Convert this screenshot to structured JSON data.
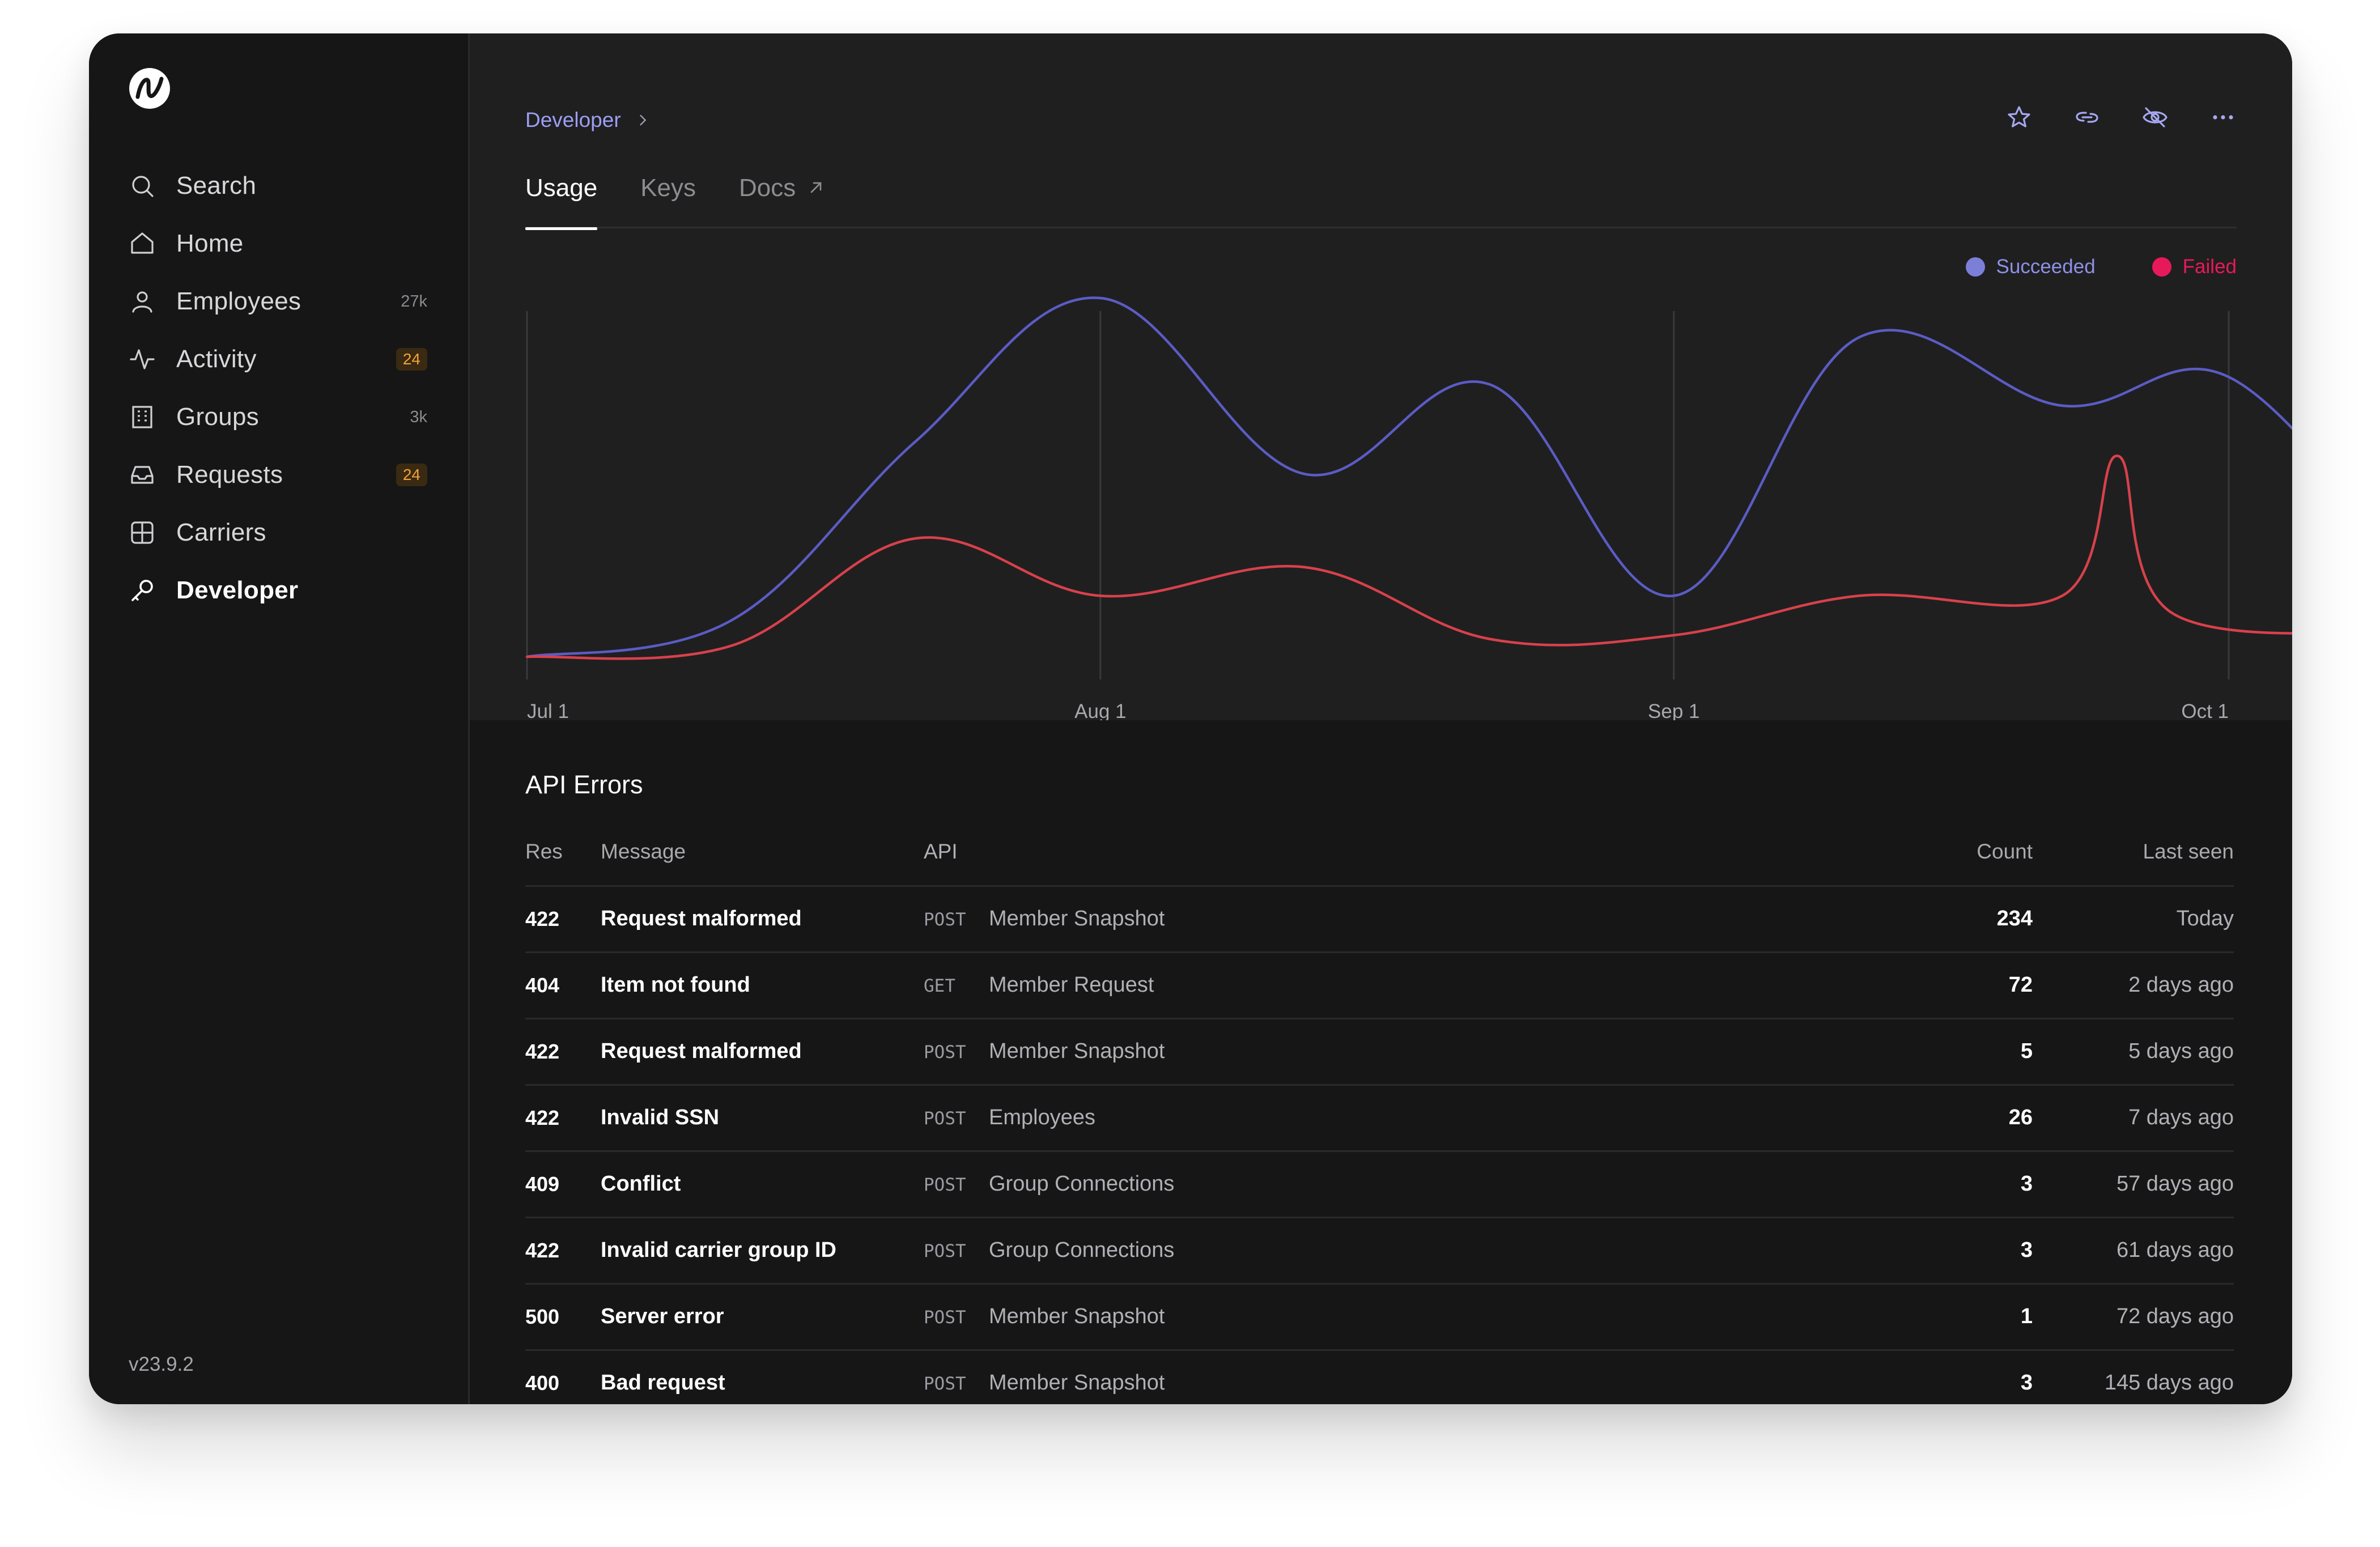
{
  "app": {
    "logo_name": "brand-logo",
    "version": "v23.9.2"
  },
  "sidebar": {
    "items": [
      {
        "name": "search",
        "label": "Search",
        "icon": "search-icon",
        "count": ""
      },
      {
        "name": "home",
        "label": "Home",
        "icon": "home-icon",
        "count": ""
      },
      {
        "name": "employees",
        "label": "Employees",
        "icon": "user-icon",
        "count": "27k"
      },
      {
        "name": "activity",
        "label": "Activity",
        "icon": "activity-icon",
        "count": "24"
      },
      {
        "name": "groups",
        "label": "Groups",
        "icon": "building-icon",
        "count": "3k"
      },
      {
        "name": "requests",
        "label": "Requests",
        "icon": "inbox-icon",
        "count": "24"
      },
      {
        "name": "carriers",
        "label": "Carriers",
        "icon": "grid-icon",
        "count": ""
      },
      {
        "name": "developer",
        "label": "Developer",
        "icon": "key-icon",
        "count": ""
      }
    ],
    "active": "Developer"
  },
  "header": {
    "breadcrumb": "Developer",
    "actions": [
      "star-icon",
      "link-icon",
      "eye-off-icon",
      "more-icon"
    ]
  },
  "tabs": {
    "usage": "Usage",
    "keys": "Keys",
    "docs": "Docs"
  },
  "colors": {
    "succeeded": "#7c7fd8",
    "failed": "#e8195a",
    "succeeded_line": "#5b5cc4",
    "failed_line": "#d8414b"
  },
  "chart_data": {
    "type": "line",
    "x_ticks": [
      "Jul 1",
      "Aug 1",
      "Sep 1",
      "Oct 1"
    ],
    "x_range": [
      "Jul 1",
      "Oct 1"
    ],
    "grid": "vertical lines at ticks",
    "legend_position": "top-right",
    "series": [
      {
        "name": "Succeeded",
        "color": "#5b5cc4",
        "points": [
          [
            "Jul 1",
            0
          ],
          [
            "Jul 12",
            10
          ],
          [
            "Jul 22",
            60
          ],
          [
            "Aug 1",
            100
          ],
          [
            "Aug 12",
            51
          ],
          [
            "Aug 22",
            76
          ],
          [
            "Sep 1",
            17
          ],
          [
            "Sep 11",
            89
          ],
          [
            "Sep 22",
            70
          ],
          [
            "Oct 1",
            78
          ],
          [
            "Oct 11",
            23
          ]
        ]
      },
      {
        "name": "Failed",
        "color": "#d8414b",
        "points": [
          [
            "Jul 1",
            0
          ],
          [
            "Jul 12",
            3
          ],
          [
            "Jul 22",
            33
          ],
          [
            "Aug 1",
            17
          ],
          [
            "Aug 12",
            25
          ],
          [
            "Aug 22",
            5
          ],
          [
            "Sep 1",
            6
          ],
          [
            "Sep 11",
            17
          ],
          [
            "Sep 22",
            17
          ],
          [
            "Sep 25",
            56
          ],
          [
            "Sep 28",
            12
          ],
          [
            "Oct 11",
            7
          ]
        ]
      }
    ]
  },
  "api_errors": {
    "title": "API Errors",
    "columns": {
      "res": "Res",
      "message": "Message",
      "api": "API",
      "count": "Count",
      "last_seen": "Last seen"
    },
    "rows": [
      {
        "res": "422",
        "message": "Request malformed",
        "method": "POST",
        "api": "Member Snapshot",
        "count": "234",
        "last_seen": "Today"
      },
      {
        "res": "404",
        "message": "Item not found",
        "method": "GET",
        "api": "Member Request",
        "count": "72",
        "last_seen": "2 days ago"
      },
      {
        "res": "422",
        "message": "Request malformed",
        "method": "POST",
        "api": "Member Snapshot",
        "count": "5",
        "last_seen": "5 days ago"
      },
      {
        "res": "422",
        "message": "Invalid SSN",
        "method": "POST",
        "api": "Employees",
        "count": "26",
        "last_seen": "7 days ago"
      },
      {
        "res": "409",
        "message": "Conflict",
        "method": "POST",
        "api": "Group Connections",
        "count": "3",
        "last_seen": "57 days ago"
      },
      {
        "res": "422",
        "message": "Invalid carrier group ID",
        "method": "POST",
        "api": "Group Connections",
        "count": "3",
        "last_seen": "61 days ago"
      },
      {
        "res": "500",
        "message": "Server error",
        "method": "POST",
        "api": "Member Snapshot",
        "count": "1",
        "last_seen": "72 days ago"
      },
      {
        "res": "400",
        "message": "Bad request",
        "method": "POST",
        "api": "Member Snapshot",
        "count": "3",
        "last_seen": "145 days ago"
      }
    ]
  }
}
